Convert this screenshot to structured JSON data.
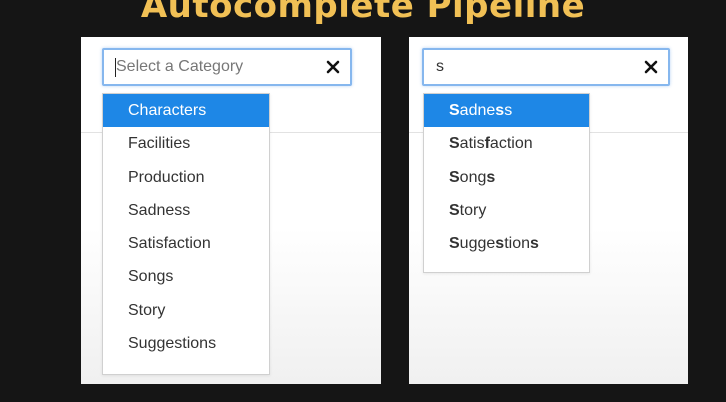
{
  "header": {
    "title": "Autocomplete Pipeline"
  },
  "left": {
    "input_value": "",
    "placeholder": "Select a Category",
    "clear_icon": "close-icon",
    "options": [
      {
        "label": "Characters",
        "highlighted": true
      },
      {
        "label": "Facilities",
        "highlighted": false
      },
      {
        "label": "Production",
        "highlighted": false
      },
      {
        "label": "Sadness",
        "highlighted": false
      },
      {
        "label": "Satisfaction",
        "highlighted": false
      },
      {
        "label": "Songs",
        "highlighted": false
      },
      {
        "label": "Story",
        "highlighted": false
      },
      {
        "label": "Suggestions",
        "highlighted": false
      }
    ]
  },
  "right": {
    "input_value": "s",
    "placeholder": "",
    "clear_icon": "close-icon",
    "options": [
      {
        "label": "Sadness",
        "highlighted": true,
        "match_positions": [
          0,
          5
        ]
      },
      {
        "label": "Satisfaction",
        "highlighted": false,
        "match_positions": [
          0,
          5
        ]
      },
      {
        "label": "Songs",
        "highlighted": false,
        "match_positions": [
          0,
          4
        ]
      },
      {
        "label": "Story",
        "highlighted": false,
        "match_positions": [
          0
        ]
      },
      {
        "label": "Suggestions",
        "highlighted": false,
        "match_positions": [
          0,
          5,
          10
        ]
      }
    ]
  },
  "colors": {
    "title": "#f1c055",
    "highlight": "#1e87e6",
    "focus_border": "#86b7ee",
    "background": "#151515"
  }
}
